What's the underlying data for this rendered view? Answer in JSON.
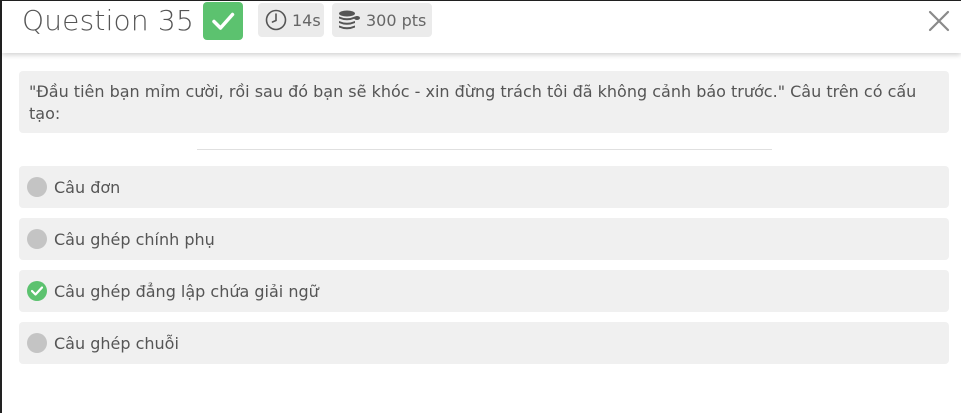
{
  "header": {
    "title": "Question 35",
    "timer": "14s",
    "points": "300 pts",
    "accent_color": "#5cc26f"
  },
  "question": {
    "text": "\"Đầu tiên bạn mỉm cười, rồi sau đó bạn sẽ khóc - xin đừng trách tôi đã không cảnh báo trước.\" Câu trên có cấu tạo:"
  },
  "answers": [
    {
      "label": "Câu đơn",
      "correct": false
    },
    {
      "label": "Câu ghép chính phụ",
      "correct": false
    },
    {
      "label": "Câu ghép đẳng lập chứa giải ngữ",
      "correct": true
    },
    {
      "label": "Câu ghép chuỗi",
      "correct": false
    }
  ]
}
